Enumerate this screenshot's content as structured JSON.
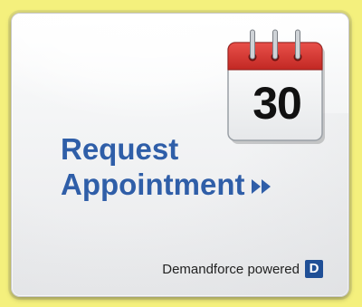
{
  "widget": {
    "calendar_day": "30",
    "cta_line1": "Request",
    "cta_line2": "Appointment",
    "footer_text": "Demandforce powered",
    "footer_logo_letter": "D",
    "colors": {
      "page_background": "#f4f07d",
      "cta_text": "#2f5ea8",
      "calendar_header": "#d2312c",
      "logo_background": "#1f4f96"
    },
    "icons": [
      "calendar-icon",
      "double-chevron-right-icon",
      "demandforce-logo-icon"
    ]
  }
}
